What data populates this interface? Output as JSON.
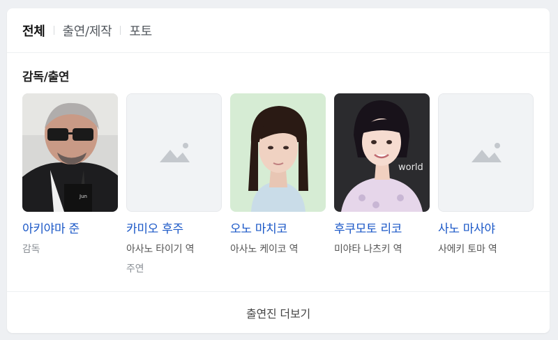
{
  "tabs": [
    {
      "label": "전체",
      "active": true
    },
    {
      "label": "출연/제작",
      "active": false
    },
    {
      "label": "포토",
      "active": false
    }
  ],
  "section": {
    "title": "감독/출연"
  },
  "people": [
    {
      "name": "아키야마 준",
      "role": "감독",
      "role2": "",
      "photo": "man-with-sunglasses"
    },
    {
      "name": "카미오 후주",
      "role": "아사노 타이기 역",
      "role2": "주연",
      "photo": "placeholder-image-icon"
    },
    {
      "name": "오노 마치코",
      "role": "아사노 케이코 역",
      "role2": "",
      "photo": "woman-light-background"
    },
    {
      "name": "후쿠모토 리코",
      "role": "미야타 나츠키 역",
      "role2": "",
      "photo": "woman-dark-background",
      "photo_text": "world"
    },
    {
      "name": "사노 마사야",
      "role": "사에키 토마 역",
      "role2": "",
      "photo": "placeholder-image-icon"
    }
  ],
  "more": {
    "label": "출연진 더보기"
  }
}
